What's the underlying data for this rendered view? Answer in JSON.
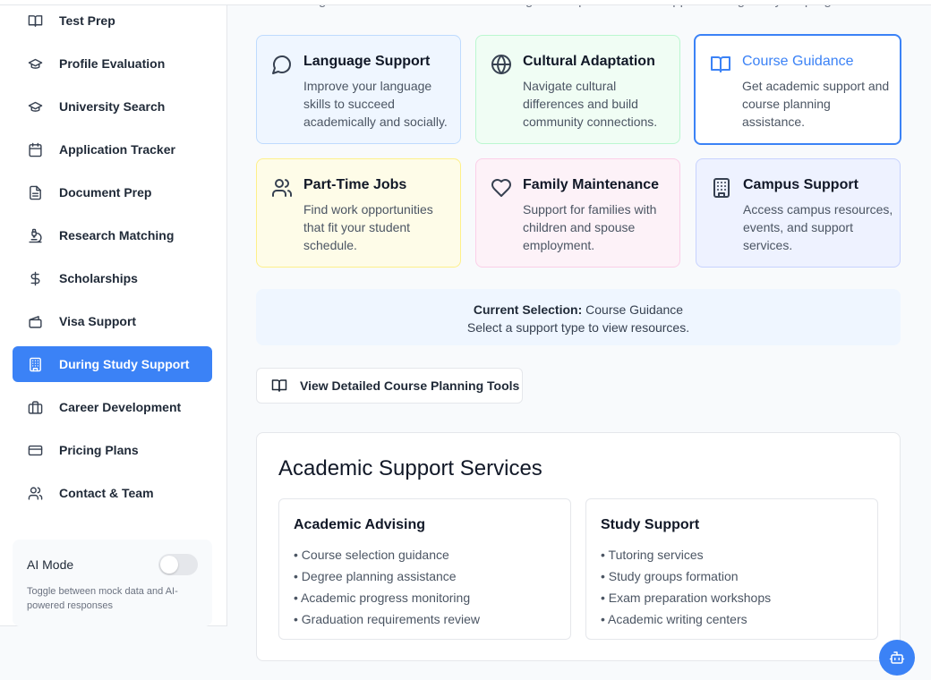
{
  "sidebar": {
    "items": [
      {
        "label": "Test Prep",
        "icon": "book-open-icon"
      },
      {
        "label": "Profile Evaluation",
        "icon": "graduation-cap-icon"
      },
      {
        "label": "University Search",
        "icon": "graduation-cap-icon"
      },
      {
        "label": "Application Tracker",
        "icon": "calendar-icon"
      },
      {
        "label": "Document Prep",
        "icon": "file-text-icon"
      },
      {
        "label": "Research Matching",
        "icon": "microscope-icon"
      },
      {
        "label": "Scholarships",
        "icon": "dollar-icon"
      },
      {
        "label": "Visa Support",
        "icon": "passport-icon"
      },
      {
        "label": "During Study Support",
        "icon": "building-icon",
        "active": true
      },
      {
        "label": "Career Development",
        "icon": "briefcase-icon"
      },
      {
        "label": "Pricing Plans",
        "icon": "credit-card-icon"
      },
      {
        "label": "Contact & Team",
        "icon": "users-icon"
      }
    ],
    "ai_mode": {
      "label": "AI Mode",
      "enabled": false,
      "description": "Toggle between mock data and AI-powered responses"
    }
  },
  "main": {
    "subtitle": "Navigate academic and cultural challenges with personalized support throughout your program.",
    "support_cards": [
      {
        "title": "Language Support",
        "description": "Improve your language skills to succeed academically and socially.",
        "icon": "message-circle-icon",
        "color": "#eff6ff",
        "border": "#bfdbfe"
      },
      {
        "title": "Cultural Adaptation",
        "description": "Navigate cultural differences and build community connections.",
        "icon": "globe-icon",
        "color": "#f0fdf4",
        "border": "#bbf7d0"
      },
      {
        "title": "Course Guidance",
        "description": "Get academic support and course planning assistance.",
        "icon": "book-open-icon",
        "selected": true
      },
      {
        "title": "Part-Time Jobs",
        "description": "Find work opportunities that fit your student schedule.",
        "icon": "users-icon",
        "color": "#fefce8",
        "border": "#fef08a"
      },
      {
        "title": "Family Maintenance",
        "description": "Support for families with children and spouse employment.",
        "icon": "heart-icon",
        "color": "#fdf2f8",
        "border": "#fbcfe8"
      },
      {
        "title": "Campus Support",
        "description": "Access campus resources, events, and support services.",
        "icon": "building-icon",
        "color": "#eef2ff",
        "border": "#c7d2fe"
      }
    ],
    "selection": {
      "label": "Current Selection:",
      "value": "Course Guidance",
      "hint": "Select a support type to view resources."
    },
    "tools_button": "View Detailed Course Planning Tools",
    "services": {
      "title": "Academic Support Services",
      "groups": [
        {
          "title": "Academic Advising",
          "items": [
            "• Course selection guidance",
            "• Degree planning assistance",
            "• Academic progress monitoring",
            "• Graduation requirements review"
          ]
        },
        {
          "title": "Study Support",
          "items": [
            "• Tutoring services",
            "• Study groups formation",
            "• Exam preparation workshops",
            "• Academic writing centers"
          ]
        }
      ]
    }
  },
  "chat_button_icon": "bot-icon",
  "colors": {
    "accent": "#3b82f6",
    "active_nav": "#3b82f6"
  }
}
